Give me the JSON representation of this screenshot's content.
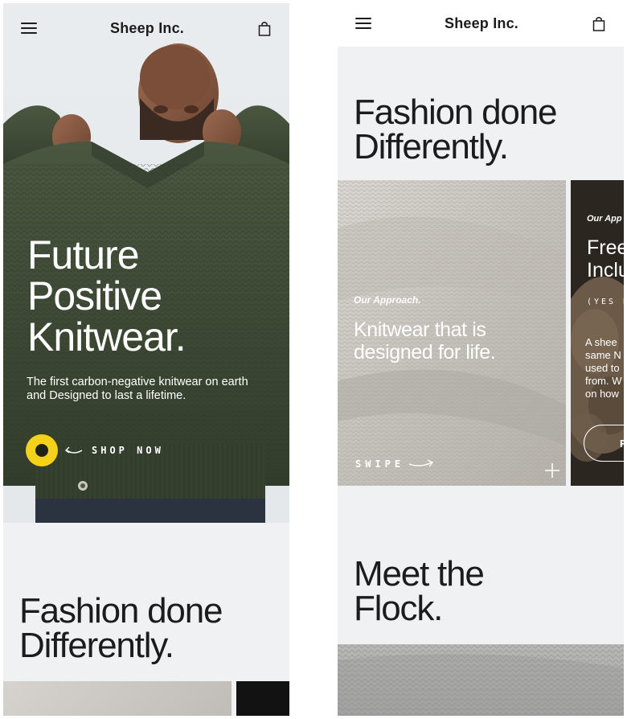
{
  "brand": "Sheep Inc.",
  "icons": {
    "menu": "hamburger-menu-icon",
    "bag": "shopping-bag-icon",
    "arrow": "curved-arrow-icon",
    "plus": "plus-icon"
  },
  "colors": {
    "accent_yellow": "#f4d21a",
    "sweater_green": "#3d4a35",
    "background": "#f0f1f3",
    "text": "#1c1c1c"
  },
  "hero": {
    "title_lines": [
      "Future",
      "Positive",
      "Knitwear."
    ],
    "subtitle": "The first carbon-negative knitwear on earth and Designed to last a lifetime.",
    "cta": "SHOP NOW"
  },
  "fashion": {
    "title_lines": [
      "Fashion done",
      "Differently."
    ]
  },
  "cards": [
    {
      "eyebrow": "Our Approach.",
      "title": "Knitwear that is designed for life.",
      "swipe": "SWIPE"
    },
    {
      "eyebrow": "Our App",
      "title_lines": [
        "Free",
        "Inclu"
      ],
      "tag": "(YES R",
      "body_lines": [
        "A shee",
        "same N",
        "used to",
        "from. W",
        "on how"
      ],
      "button": "R"
    }
  ],
  "flock": {
    "title_lines": [
      "Meet the",
      "Flock."
    ]
  }
}
